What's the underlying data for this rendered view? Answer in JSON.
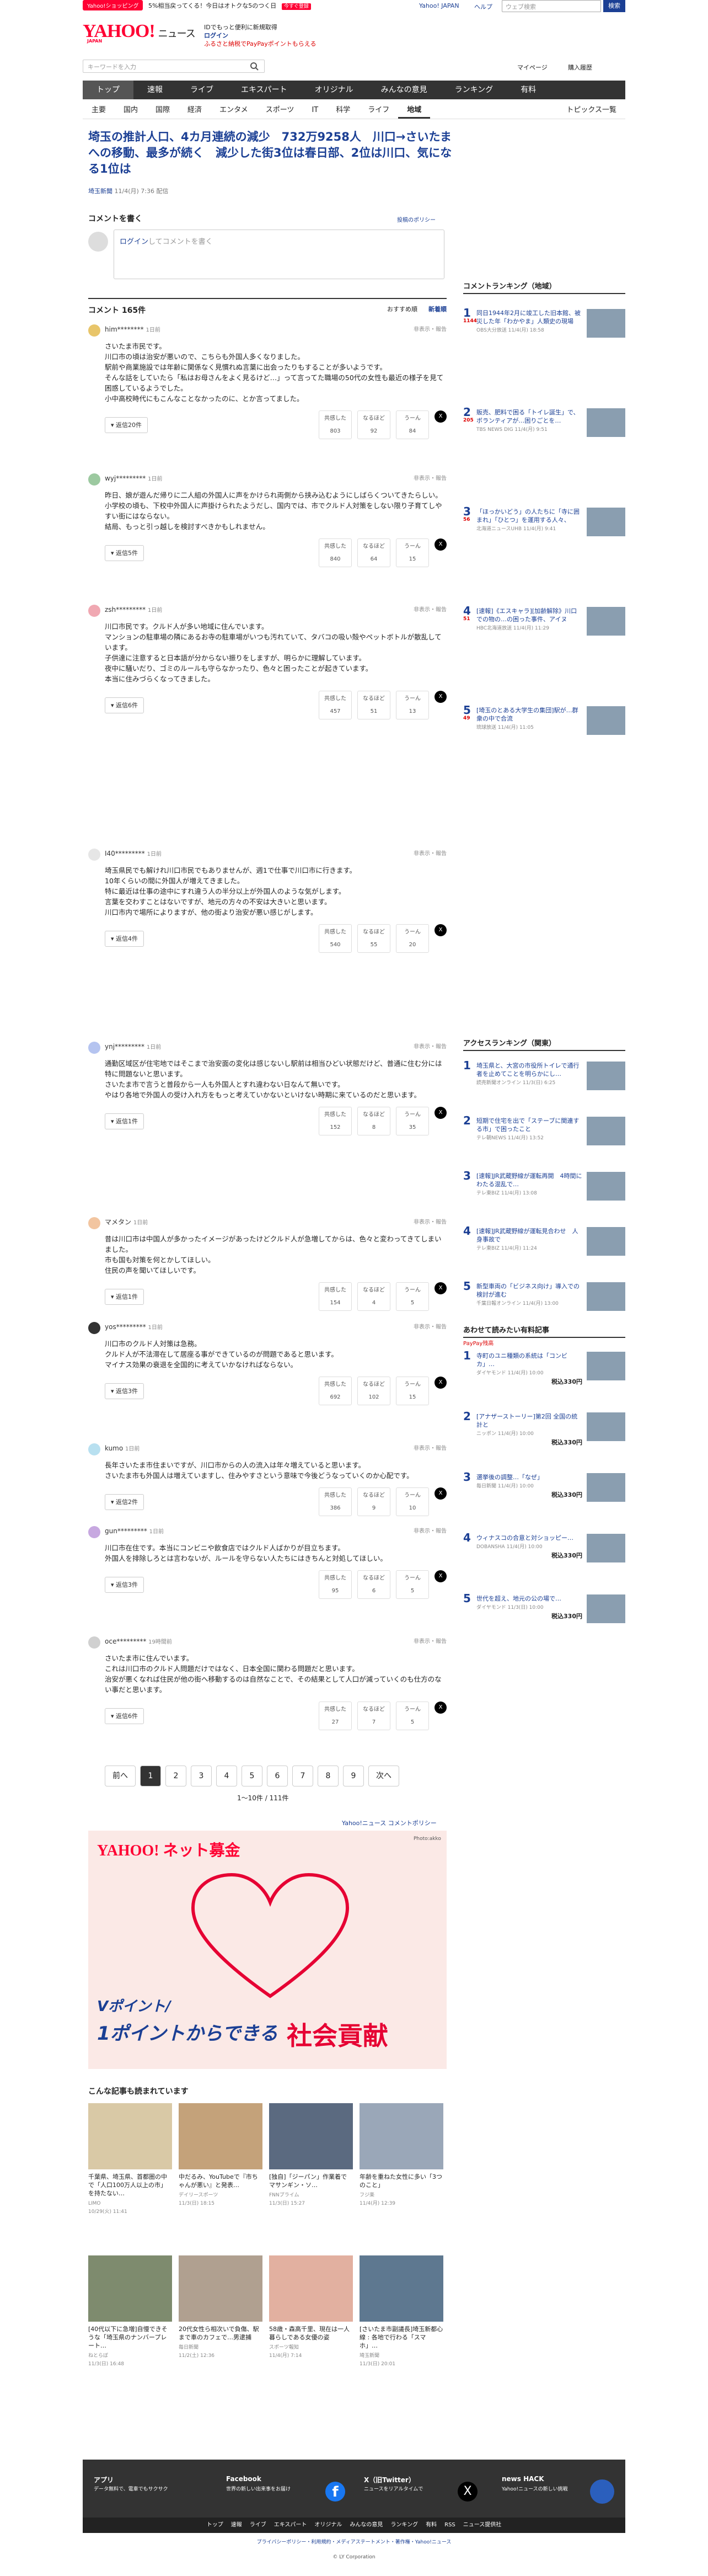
{
  "top": {
    "promo": "Yahoo!ショッピング",
    "promo_text": "5%相当戻ってくる！今日はオトクな5のつく日",
    "promo_btn": "今すぐ登録",
    "links": [
      "Yahoo! JAPAN",
      "ヘルプ"
    ],
    "search_ph": "ウェブ検索",
    "search_btn": "検索"
  },
  "logo": {
    "name": "YAHOO!",
    "sub": "JAPAN",
    "service": "ニュース"
  },
  "header": {
    "line1": "IDでもっと便利に新規取得",
    "line2": "ログイン",
    "line3": "ふるさと納税でPayPayポイントもらえる"
  },
  "search": {
    "ph": "キーワードを入力"
  },
  "hlinks": [
    "マイページ",
    "購入履歴"
  ],
  "nav1": [
    "トップ",
    "速報",
    "ライブ",
    "エキスパート",
    "オリジナル",
    "みんなの意見",
    "ランキング",
    "有料"
  ],
  "nav2": [
    "主要",
    "国内",
    "国際",
    "経済",
    "エンタメ",
    "スポーツ",
    "IT",
    "科学",
    "ライフ",
    "地域"
  ],
  "nav2_right": "トピックス一覧",
  "article": {
    "title": "埼玉の推計人口、4カ月連続の減少　732万9258人　川口→さいたまへの移動、最多が続く　減少した街3位は春日部、2位は川口、気になる1位は",
    "source": "埼玉新聞",
    "date": "11/4(月) 7:36 配信"
  },
  "write": {
    "heading": "コメントを書く",
    "policy": "投稿のポリシー",
    "login": "ログイン",
    "placeholder": "してコメントを書く"
  },
  "comments_header": {
    "count": "コメント 165件",
    "sort1": "おすすめ順",
    "sort2": "新着順"
  },
  "comments": [
    {
      "user": "him********",
      "ago": "1日前",
      "text": "さいたま市民です。\n川口市の頃は治安が悪いので、こちらも外国人多くなりました。\n駅前や商業施設では年齢に関係なく見慣れぬ言葉に出会ったりもすることが多いようです。\nそんな話をしていたら「私はお母さんをよく見るけど…」って言ってた職場の50代の女性も最近の様子を見て困惑しているようでした。\n小中高校時代にもこんなことなかったのに、とか言ってました。",
      "replies": "返信20件",
      "v": [
        "803",
        "92",
        "84"
      ]
    },
    {
      "user": "wyj*********",
      "ago": "1日前",
      "text": "昨日、娘が遊んだ帰りに二人組の外国人に声をかけられ両側から挟み込むようにしばらくついてきたらしい。\n小学校の頃も、下校中外国人に声掛けられたようだし、国内では、市でクルド人対策をしない限り子育てしやすい街にはならない。\n結局、もっと引っ越しを検討すべきかもしれません。",
      "replies": "返信5件",
      "v": [
        "840",
        "64",
        "15"
      ]
    },
    {
      "user": "zsh*********",
      "ago": "1日前",
      "text": "川口市民です。クルド人が多い地域に住んでいます。\nマンションの駐車場の隣にあるお寺の駐車場がいつも汚れていて、タバコの吸い殻やペットボトルが散乱しています。\n子供達に注意すると日本語が分からない振りをしますが、明らかに理解しています。\n夜中に騒いだり、ゴミのルールも守らなかったり、色々と困ったことが起きています。\n本当に住みづらくなってきました。",
      "replies": "返信6件",
      "v": [
        "457",
        "51",
        "13"
      ]
    },
    {
      "user": "I40*********",
      "ago": "1日前",
      "text": "埼玉県民でも解けれ川口市民でもありませんが、週1で仕事で川口市に行きます。\n10年くらいの間に外国人が増えてきました。\n特に最近は仕事の途中にすれ違う人の半分以上が外国人のような気がします。\n言葉を交わすことはないですが、地元の方々の不安は大きいと思います。\n川口市内で場所によりますが、他の街より治安が悪い感じがします。",
      "replies": "返信4件",
      "v": [
        "540",
        "55",
        "20"
      ]
    },
    {
      "user": "ynj*********",
      "ago": "1日前",
      "text": "通勤区域区が住宅地ではそこまで治安面の変化は感じないし駅前は相当ひどい状態だけど、普通に住む分には特に問題ないと思います。\nさいたま市で言うと普段から一人も外国人とすれ違わない日なんて無いです。\nやはり各地で外国人の受け入れ方をもっと考えていかないといけない時期に来ているのだと思います。",
      "replies": "返信1件",
      "v": [
        "152",
        "8",
        "35"
      ]
    },
    {
      "user": "マメタン",
      "ago": "1日前",
      "text": "昔は川口市は中国人が多かったイメージがあったけどクルド人が急増してからは、色々と変わってきてしまいました。\n市も国も対策を何とかしてほしい。\n住民の声を聞いてほしいです。",
      "replies": "返信1件",
      "v": [
        "154",
        "4",
        "5"
      ]
    },
    {
      "user": "yos*********",
      "ago": "1日前",
      "text": "川口市のクルド人対策は急務。\nクルド人が不法滞在して居座る事ができているのが問題であると思います。\nマイナス効果の衰退を全国的に考えていかなければならない。",
      "replies": "返信3件",
      "v": [
        "692",
        "102",
        "15"
      ]
    },
    {
      "user": "kumo",
      "ago": "1日前",
      "text": "長年さいたま市住まいですが、川口市からの人の流入は年々増えていると思います。\nさいたま市も外国人は増えていますし、住みやすさという意味で今後どうなっていくのか心配です。",
      "replies": "返信2件",
      "v": [
        "386",
        "9",
        "10"
      ]
    },
    {
      "user": "gun*********",
      "ago": "1日前",
      "text": "川口市在住です。本当にコンビニや飲食店ではクルド人ばかりが目立ちます。\n外国人を排除しろとは言わないが、ルールを守らない人たちにはきちんと対処してほしい。",
      "replies": "返信3件",
      "v": [
        "95",
        "6",
        "5"
      ]
    },
    {
      "user": "oce*********",
      "ago": "19時間前",
      "text": "さいたま市に住んでいます。\nこれは川口市のクルド人問題だけではなく、日本全国に関わる問題だと思います。\n治安が悪くなれば住民が他の街へ移動するのは自然なことで、その結果として人口が減っていくのも仕方のない事だと思います。",
      "replies": "返信6件",
      "v": [
        "27",
        "7",
        "5"
      ]
    }
  ],
  "react_labels": [
    "共感した",
    "なるほど",
    "うーん"
  ],
  "pager": {
    "prev": "前へ",
    "pages": [
      "1",
      "2",
      "3",
      "4",
      "5",
      "6",
      "7",
      "8",
      "9"
    ],
    "next": "次へ",
    "summary": "1〜10件 / 111件"
  },
  "ad_label": "Yahoo!ニュース コメントポリシー",
  "donation": {
    "brand": "YAHOO! ネット募金",
    "line1": "Vポイント/",
    "line2": "1ポイントからできる",
    "line3": "社会貢献",
    "credit": "Photo:akko"
  },
  "also_read": {
    "heading": "こんな記事も読まれています",
    "items": [
      {
        "t": "千葉県、埼玉県、首都圏の中で「人口100万人以上の市」を持たない…",
        "s": "LIMO",
        "d": "10/29(火) 11:41"
      },
      {
        "t": "中だるみ、YouTubeで『市ちゃんが悪い』と発表…",
        "s": "デイリースポーツ",
        "d": "11/3(日) 18:15"
      },
      {
        "t": "[独自]「ジーパン」作業着でマサンギン・ソ…",
        "s": "FNNプライム",
        "d": "11/3(日) 15:27"
      },
      {
        "t": "年齢を重ねた女性に多い「3つのこと」",
        "s": "フジ楽",
        "d": "11/4(月) 12:39"
      },
      {
        "t": "[40代以下に急増]自慢できそうな「埼玉県のナンバープレート…",
        "s": "ねとらぼ",
        "d": "11/3(日) 16:48"
      },
      {
        "t": "20代女性ら相次いで負傷、駅まで車のカフェで…男逮捕",
        "s": "毎日新聞",
        "d": "11/2(土) 12:36"
      },
      {
        "t": "58歳・森高千里、現在は一人暮らしである女優の姿",
        "s": "スポーツ報知",
        "d": "11/4(月) 7:14"
      },
      {
        "t": "[さいたま市副議長]埼玉新都心線 : 各地で行わる「スマホ」…",
        "s": "埼玉新聞",
        "d": "11/3(日) 20:01"
      }
    ]
  },
  "side_rank": {
    "heading": "コメントランキング（地域）",
    "items": [
      {
        "t": "同日1944年2月に竣工した旧本館、被災した年「わかやま」人類史の現場",
        "c": "1144",
        "s": "OBS大分放送",
        "d": "11/4(月) 18:58"
      },
      {
        "t": "販売、肥料で困る「トイレ誕生」で、ボランティアが…困りごとを…",
        "c": "205",
        "s": "TBS NEWS DIG",
        "d": "11/4(月) 9:51"
      },
      {
        "t": "「ほっかいどう」の人たちに「寺に囲まれ」「ひとつ」を運用する人々、",
        "c": "56",
        "s": "北海道ニュースUHB",
        "d": "11/4(月) 9:41"
      },
      {
        "t": "[速報]《エスキャラ][加齢解除》川口での物の…の困った事件、アイヌ",
        "c": "51",
        "s": "HBC北海道放送",
        "d": "11/4(月) 11:29"
      },
      {
        "t": "[埼玉のとある大学生の集団]駅が…群衆の中で合流",
        "c": "49",
        "s": "琉球放送",
        "d": "11/4(月) 11:05"
      }
    ]
  },
  "side_access": {
    "heading": "アクセスランキング（関東）",
    "items": [
      {
        "t": "埼玉県と、大宮の市役所トイレで通行者を止めてことを明らかにし…",
        "s": "読売新聞オンライン",
        "d": "11/3(日) 6:25"
      },
      {
        "t": "短期で住宅を出で「ステーブに関連する市」で困ったこと",
        "s": "テレ朝NEWS",
        "d": "11/4(月) 13:52"
      },
      {
        "t": "[速報]JR武蔵野線が運転再開　4時間にわたる混乱で…",
        "s": "テレ東BIZ",
        "d": "11/4(月) 13:08"
      },
      {
        "t": "[速報]JR武蔵野線が運転見合わせ　人身事故で",
        "s": "テレ東BIZ",
        "d": "11/4(月) 11:24"
      },
      {
        "t": "新型車両の「ビジネス向け」導入での検討が進む",
        "s": "千葉日報オンライン",
        "d": "11/4(月) 13:00"
      }
    ]
  },
  "paid": {
    "heading": "あわせて読みたい有料記事",
    "badge": "PayPay残高",
    "items": [
      {
        "t": "寺町のユニ種類の系統は「コンビカ」…",
        "s": "ダイヤモンド",
        "d": "11/4(月) 10:00",
        "p": "税込330円"
      },
      {
        "t": "[アナザーストーリー]第2回 全国の統計と",
        "s": "ニッポン",
        "d": "11/4(月) 10:00",
        "p": "税込330円"
      },
      {
        "t": "選挙後の調整…「なぜ」",
        "s": "毎日新聞",
        "d": "11/4(月) 10:00",
        "p": "税込330円"
      },
      {
        "t": "ウィナスコの合意と対ショッピー…",
        "s": "DOBANSHA",
        "d": "11/4(月) 10:00",
        "p": "税込330円"
      },
      {
        "t": "世代を超え、地元の公の場で…",
        "s": "ダイヤモンド",
        "d": "11/3(日) 10:00",
        "p": "税込330円"
      }
    ]
  },
  "footer": {
    "app": "アプリ",
    "app_desc": "データ無料で、電車でもサクサク",
    "fb": "Facebook",
    "fb_desc": "世界の新しい出来事をお届け",
    "x": "X（旧Twitter）",
    "x_desc": "ニュースをリアルタイムで",
    "hack": "news HACK",
    "hack_desc": "Yahoo!ニュースの新しい挑戦",
    "links": [
      "トップ",
      "速報",
      "ライブ",
      "エキスパート",
      "オリジナル",
      "みんなの意見",
      "ランキング",
      "有料",
      "RSS",
      "ニュース提供社"
    ],
    "legal": "プライバシーポリシー・利用規約・メディアステートメント・著作権・Yahoo!ニュース",
    "copy": "© LY Corporation"
  }
}
